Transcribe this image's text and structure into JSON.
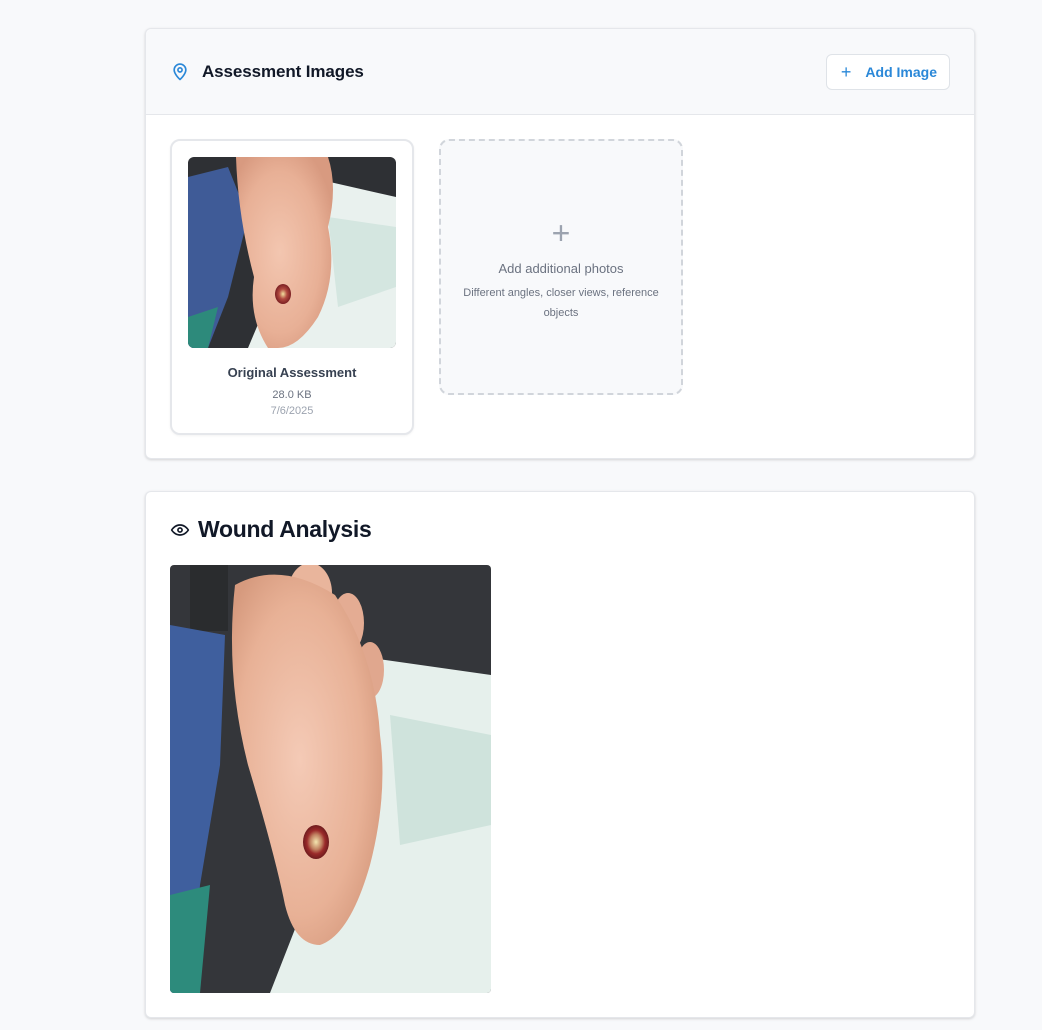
{
  "assessment_images": {
    "title": "Assessment Images",
    "add_button_label": "Add Image",
    "images": [
      {
        "title": "Original Assessment",
        "size": "28.0 KB",
        "date": "7/6/2025"
      }
    ],
    "add_tile": {
      "title": "Add additional photos",
      "description": "Different angles, closer views, reference objects"
    }
  },
  "wound_analysis": {
    "title": "Wound Analysis"
  },
  "colors": {
    "accent": "#2b88d8",
    "card_border": "#e5e7eb",
    "page_background": "#f8f9fb"
  },
  "icons": {
    "header": "map-pin-icon",
    "add": "plus-icon",
    "analysis": "eye-icon"
  }
}
